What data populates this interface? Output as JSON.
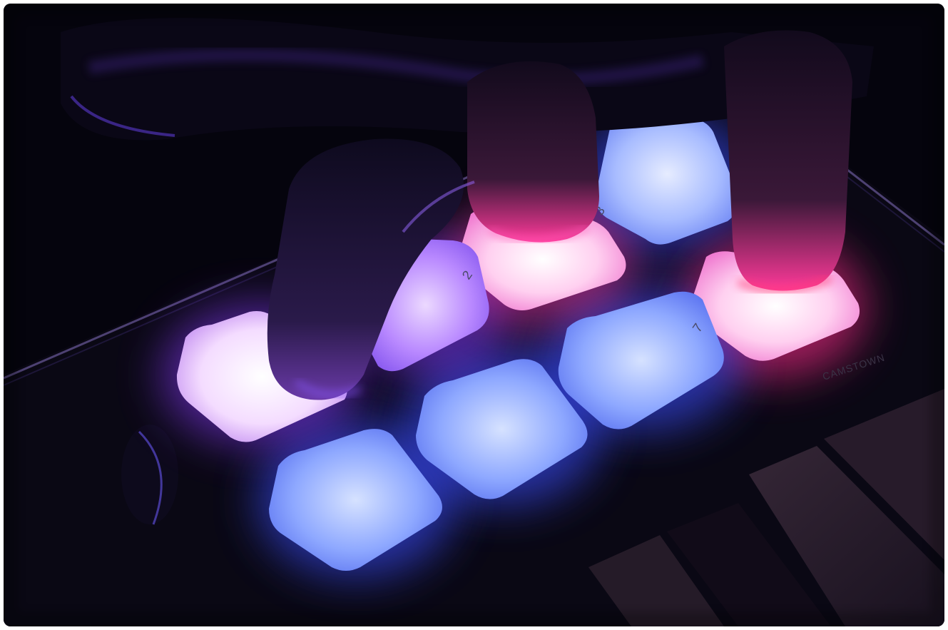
{
  "scene": {
    "description_colors": {
      "background": "#05040d",
      "pad_blue": "#9fb8ff",
      "pad_violet": "#c9a3ff",
      "pad_pink": "#ffb8e6",
      "glow_blue": "#3a4dff",
      "glow_magenta": "#ff2a8a"
    },
    "pad_labels": {
      "pad2": "2",
      "pad3": "3",
      "pad7": "7"
    },
    "brand_text": "CAMSTOWN"
  }
}
